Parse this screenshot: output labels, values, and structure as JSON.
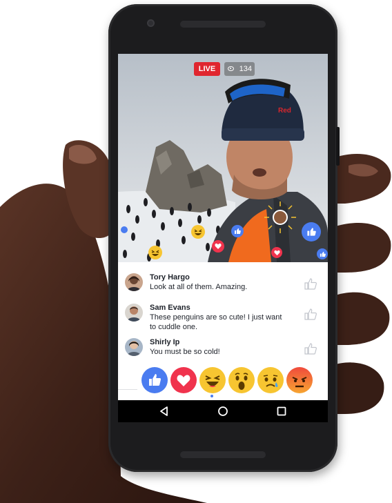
{
  "stream": {
    "live_label": "LIVE",
    "viewer_count": "134"
  },
  "comments": [
    {
      "name": "Tory Hargo",
      "text": "Look at all of them. Amazing."
    },
    {
      "name": "Sam Evans",
      "text": "These penguins are so cute! I just want to cuddle one."
    },
    {
      "name": "Shirly Ip",
      "text": "You must be so cold!"
    }
  ],
  "reactions": [
    "like-icon",
    "love-icon",
    "haha-icon",
    "wow-icon",
    "sad-icon",
    "angry-icon"
  ],
  "navigation": [
    "back-icon",
    "home-icon",
    "recents-icon"
  ],
  "colors": {
    "live_red": "#e0262f",
    "facebook_blue": "#4a7cf0",
    "love_red": "#f0334d",
    "emoji_yellow": "#f7c531",
    "angry_orange": "#f06a3c"
  }
}
